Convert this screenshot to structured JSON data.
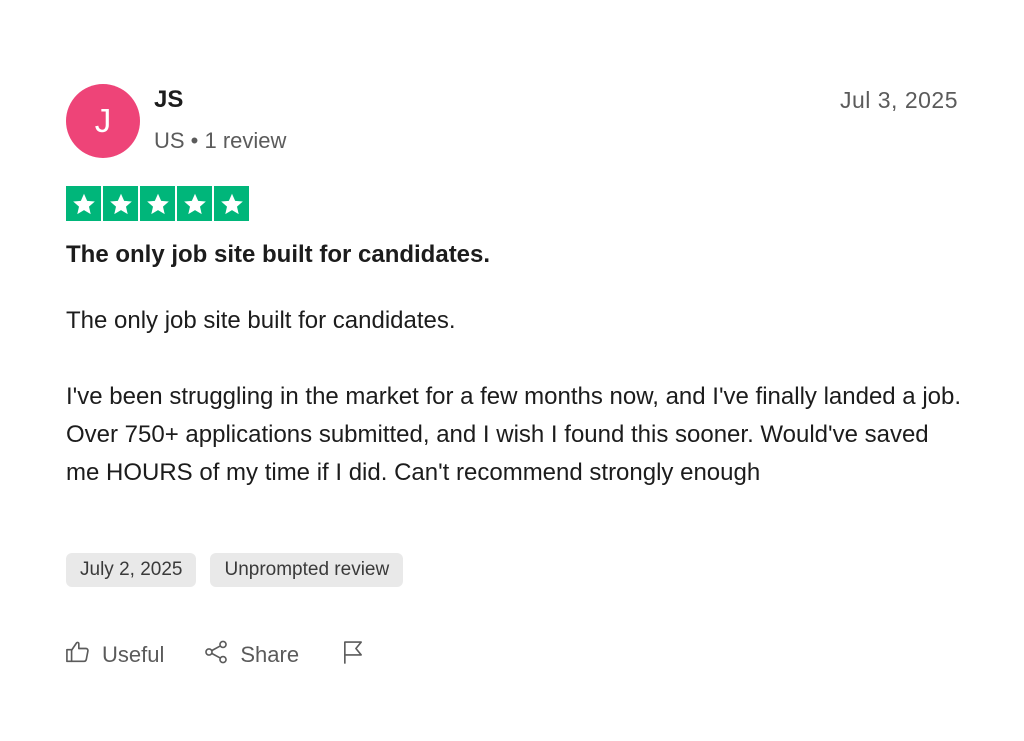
{
  "reviewer": {
    "initial": "J",
    "name": "JS",
    "meta": "US • 1 review",
    "avatar_color": "#ee4478"
  },
  "review": {
    "date_posted": "Jul 3, 2025",
    "rating": 5,
    "star_color": "#00b67a",
    "title": "The only job site built for candidates.",
    "body_line1": "The only job site built for candidates.",
    "body_line2": "I've been struggling in the market for a few months now, and I've finally landed a job. Over 750+ applications submitted, and I wish I found this sooner. Would've saved me HOURS of my time if I did. Can't recommend strongly enough"
  },
  "tags": [
    "July 2, 2025",
    "Unprompted review"
  ],
  "actions": {
    "useful_label": "Useful",
    "share_label": "Share",
    "useful_icon": "thumbs-up-icon",
    "share_icon": "share-icon",
    "flag_icon": "flag-icon"
  }
}
